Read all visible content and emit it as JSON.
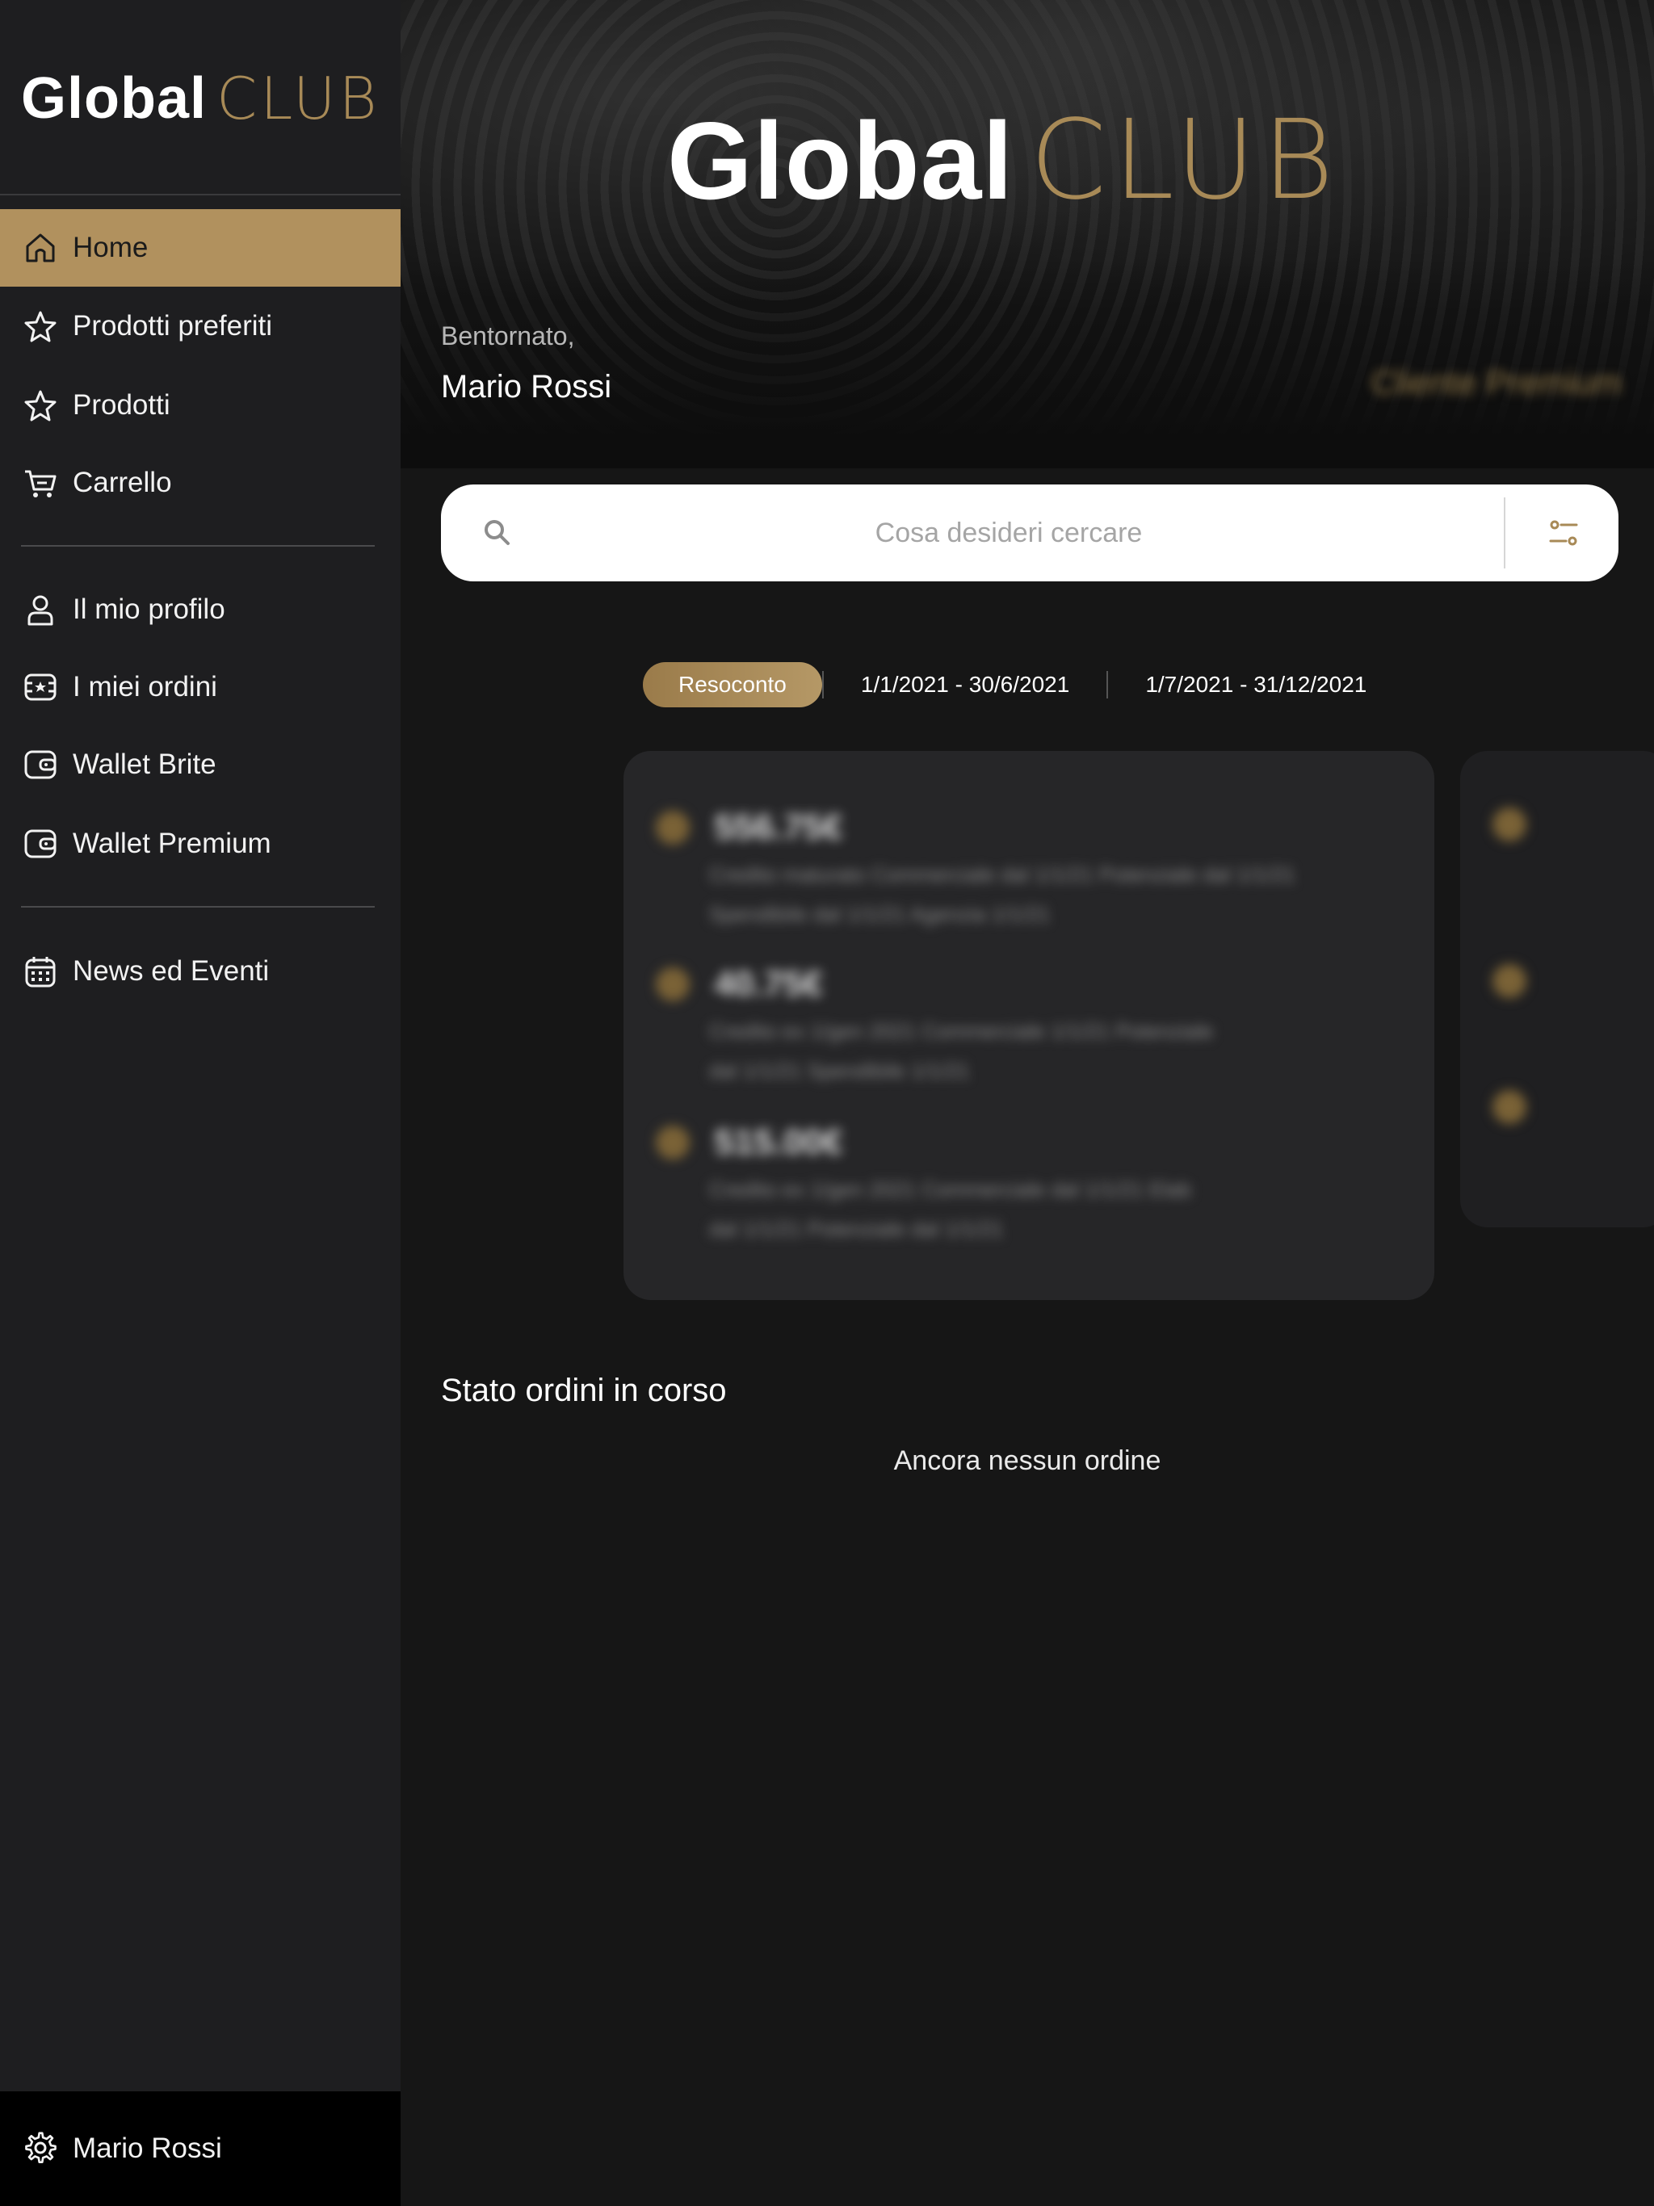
{
  "brand": {
    "word": "lobal",
    "club": "CLUB",
    "initial": "G"
  },
  "sidebar": {
    "items": [
      {
        "label": "Home",
        "icon": "home-icon",
        "active": true
      },
      {
        "label": "Prodotti preferiti",
        "icon": "star-icon"
      },
      {
        "label": "Prodotti",
        "icon": "star-icon"
      },
      {
        "label": "Carrello",
        "icon": "cart-icon"
      },
      {
        "label": "Il mio profilo",
        "icon": "user-icon"
      },
      {
        "label": "I miei ordini",
        "icon": "orders-icon"
      },
      {
        "label": "Wallet Brite",
        "icon": "wallet-icon"
      },
      {
        "label": "Wallet Premium",
        "icon": "wallet-icon"
      },
      {
        "label": "News ed Eventi",
        "icon": "calendar-icon"
      }
    ],
    "footer": {
      "label": "Mario Rossi",
      "icon": "gear-icon"
    }
  },
  "welcome": {
    "greeting": "Bentornato,",
    "name": "Mario Rossi"
  },
  "tier": "Cliente Premium",
  "search": {
    "placeholder": "Cosa desideri cercare",
    "value": ""
  },
  "tabs": [
    {
      "label": "Resoconto",
      "active": true
    },
    {
      "label": "1/1/2021 - 30/6/2021"
    },
    {
      "label": "1/7/2021 - 31/12/2021"
    }
  ],
  "summary": {
    "rows": [
      {
        "value": "556.75€",
        "line1": "Credito maturato Commerciale dal 1/1/21 Potenziale dal 1/1/21",
        "line2": "Spendibile dal 1/1/21 Agenzia 1/1/21"
      },
      {
        "value": "40.75€",
        "line1": "Credito ex 1/gen 2021 Commerciale 1/1/21 Potenziale",
        "line2": "dal 1/1/21 Spendibile 1/1/21"
      },
      {
        "value": "515.00€",
        "line1": "Credito ex 1/gen 2021 Commerciale dal 1/1/21 Elab",
        "line2": "dal 1/1/21 Potenziale dal 1/1/21"
      }
    ]
  },
  "orders": {
    "title": "Stato ordini in corso",
    "empty": "Ancora nessun ordine"
  },
  "colors": {
    "accent": "#b1915e",
    "sidebar": "#1e1e20",
    "main": "#161616"
  }
}
